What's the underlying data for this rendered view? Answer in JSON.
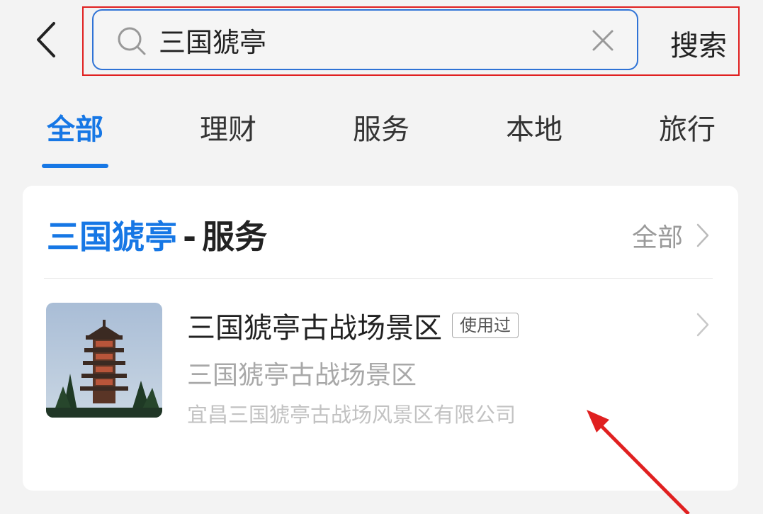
{
  "header": {
    "back_icon": "chevron-left-icon",
    "search": {
      "value": "三国猇亭",
      "placeholder": ""
    },
    "search_button": "搜索"
  },
  "tabs": [
    {
      "label": "全部",
      "active": true
    },
    {
      "label": "理财",
      "active": false
    },
    {
      "label": "服务",
      "active": false
    },
    {
      "label": "本地",
      "active": false
    },
    {
      "label": "旅行",
      "active": false
    }
  ],
  "section": {
    "keyword": "三国猇亭",
    "separator": "-",
    "category": "服务",
    "all_label": "全部"
  },
  "result": {
    "title": "三国猇亭古战场景区",
    "badge": "使用过",
    "subtitle": "三国猇亭古战场景区",
    "company": "宜昌三国猇亭古战场风景区有限公司"
  },
  "colors": {
    "accent": "#1677e5",
    "annotation": "#e02020",
    "search_border": "#2f73d6"
  }
}
